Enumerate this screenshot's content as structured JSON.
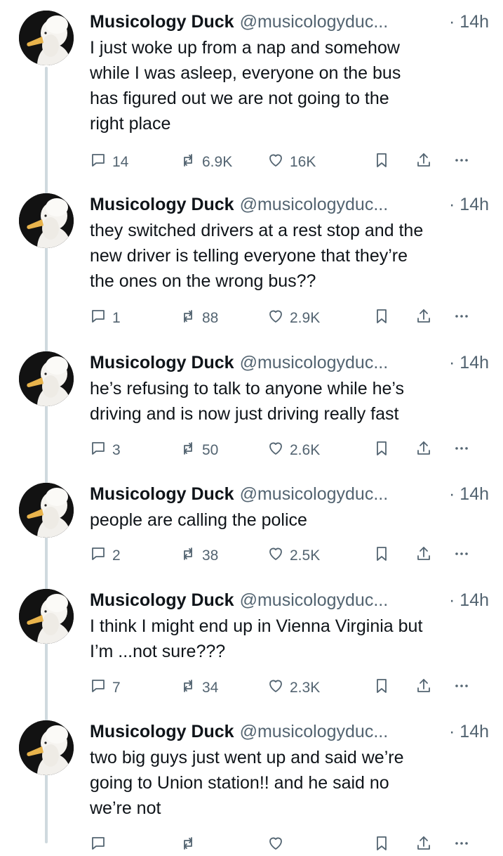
{
  "tweets": [
    {
      "name": "Musicology Duck",
      "handle": "@musicologyduc...",
      "time": "· 14h",
      "lines": [
        "I just woke up from a nap and somehow",
        "while I was asleep, everyone on the bus",
        "has figured out we are not going to the",
        "right place"
      ],
      "replies": "14",
      "retweets": "6.9K",
      "likes": "16K"
    },
    {
      "name": "Musicology Duck",
      "handle": "@musicologyduc...",
      "time": "· 14h",
      "lines": [
        "they switched drivers at a rest stop and the",
        "new driver is telling everyone that they’re",
        "the ones on the wrong bus??"
      ],
      "replies": "1",
      "retweets": "88",
      "likes": "2.9K"
    },
    {
      "name": "Musicology Duck",
      "handle": "@musicologyduc...",
      "time": "· 14h",
      "lines": [
        "he’s refusing to talk to anyone while he’s",
        "driving and is now just driving really fast"
      ],
      "replies": "3",
      "retweets": "50",
      "likes": "2.6K"
    },
    {
      "name": "Musicology Duck",
      "handle": "@musicologyduc...",
      "time": "· 14h",
      "lines": [
        "people are calling the police"
      ],
      "replies": "2",
      "retweets": "38",
      "likes": "2.5K"
    },
    {
      "name": "Musicology Duck",
      "handle": "@musicologyduc...",
      "time": "· 14h",
      "lines": [
        "I think I might end up in Vienna Virginia but",
        "I’m ...not sure???"
      ],
      "replies": "7",
      "retweets": "34",
      "likes": "2.3K"
    },
    {
      "name": "Musicology Duck",
      "handle": "@musicologyduc...",
      "time": "· 14h",
      "lines": [
        "two big guys just went up and said we’re",
        "going to Union station!! and he said no",
        "we’re not"
      ],
      "replies": "",
      "retweets": "",
      "likes": ""
    }
  ],
  "icons": {
    "reply": "reply-icon",
    "retweet": "retweet-icon",
    "like": "heart-icon",
    "bookmark": "bookmark-icon",
    "share": "share-icon",
    "more": "more-icon"
  },
  "colors": {
    "text": "#0f1419",
    "muted": "#536471",
    "thread_line": "#cfd9de"
  }
}
